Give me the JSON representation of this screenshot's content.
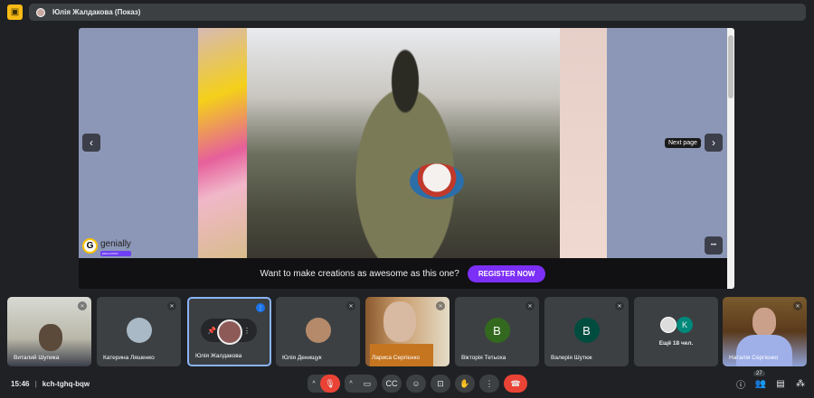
{
  "header": {
    "presenter": "Юлія Жалдакова (Показ)"
  },
  "presentation": {
    "tooltip": "Next page",
    "prev": "‹",
    "next": "›",
    "more": "•••",
    "brand": "genially",
    "brand_badge": "EDUCATION",
    "banner_text": "Want to make creations as awesome as this one?",
    "register": "REGISTER NOW"
  },
  "participants": [
    {
      "name": "Виталий Шупика"
    },
    {
      "name": "Катерина Ляшенко"
    },
    {
      "name": "Юлія Жалдакова"
    },
    {
      "name": "Юлія Денищук"
    },
    {
      "name": "Лариса Сергієнко"
    },
    {
      "name": "Вікторія Тетьоха",
      "initial": "В",
      "color": "#33691e"
    },
    {
      "name": "Валерія Шутюк",
      "initial": "В",
      "color": "#004d40"
    },
    {
      "name": "Ещё 18 чел.",
      "initial": "K",
      "color": "#00897b"
    },
    {
      "name": "Наталія Сергієнко"
    }
  ],
  "footer": {
    "time": "15:46",
    "code": "kch-tghq-bqw",
    "people_count": "27"
  }
}
